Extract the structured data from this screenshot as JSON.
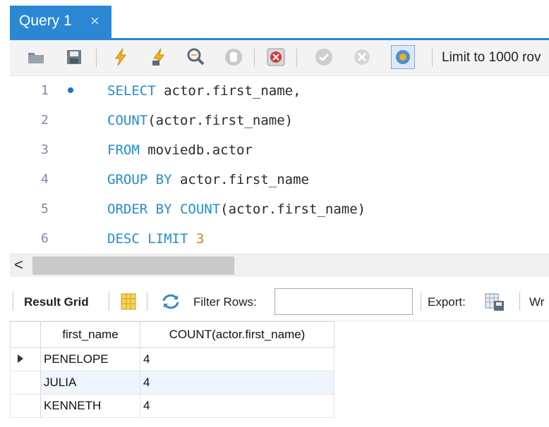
{
  "tab": {
    "title": "Query 1",
    "close": "×"
  },
  "toolbar": {
    "limit_label": "Limit to 1000 rov",
    "icons": [
      "folder-open-icon",
      "save-icon",
      "execute-icon",
      "execute-current-icon",
      "explain-icon",
      "stop-icon",
      "toggle-error-icon",
      "commit-icon",
      "rollback-icon",
      "autocommit-icon"
    ]
  },
  "editor": {
    "lines": [
      {
        "num": "1",
        "tokens": [
          {
            "t": "SELECT",
            "k": "kw"
          },
          {
            "t": " actor.first_name,",
            "k": ""
          }
        ]
      },
      {
        "num": "2",
        "tokens": [
          {
            "t": "COUNT",
            "k": "kw"
          },
          {
            "t": "(actor.first_name)",
            "k": ""
          }
        ]
      },
      {
        "num": "3",
        "tokens": [
          {
            "t": "FROM",
            "k": "kw"
          },
          {
            "t": " moviedb.actor",
            "k": ""
          }
        ]
      },
      {
        "num": "4",
        "tokens": [
          {
            "t": "GROUP BY",
            "k": "kw"
          },
          {
            "t": " actor.first_name",
            "k": ""
          }
        ]
      },
      {
        "num": "5",
        "tokens": [
          {
            "t": "ORDER BY",
            "k": "kw"
          },
          {
            "t": " ",
            "k": ""
          },
          {
            "t": "COUNT",
            "k": "kw"
          },
          {
            "t": "(actor.first_name)",
            "k": ""
          }
        ]
      },
      {
        "num": "6",
        "tokens": [
          {
            "t": "DESC",
            "k": "kw"
          },
          {
            "t": " ",
            "k": ""
          },
          {
            "t": "LIMIT",
            "k": "kw"
          },
          {
            "t": " ",
            "k": ""
          },
          {
            "t": "3",
            "k": "num"
          }
        ]
      }
    ]
  },
  "scroll": {
    "left_arrow": "<"
  },
  "results": {
    "grid_label": "Result Grid",
    "filter_label": "Filter Rows:",
    "filter_value": "",
    "export_label": "Export:",
    "wrap_label": "Wr",
    "columns": [
      "first_name",
      "COUNT(actor.first_name)"
    ],
    "rows": [
      [
        "PENELOPE",
        "4"
      ],
      [
        "JULIA",
        "4"
      ],
      [
        "KENNETH",
        "4"
      ]
    ]
  },
  "colors": {
    "accent": "#2b87d4",
    "keyword": "#1f8fd2",
    "number": "#e07a26"
  }
}
